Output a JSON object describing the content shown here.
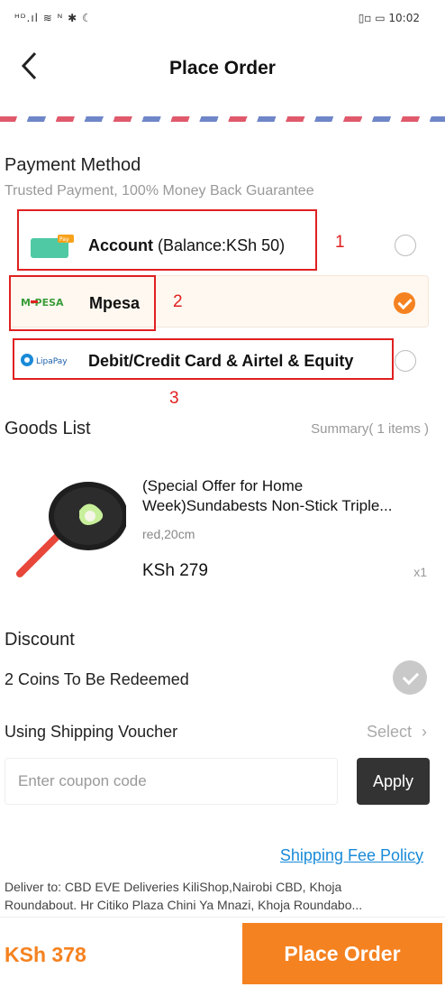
{
  "status_bar": {
    "left": "ᴴᴰ.ıl ≋ ᴺ ✱ ☾",
    "right": "▯▫ ▭ 10:02"
  },
  "header": {
    "title": "Place Order"
  },
  "payment": {
    "title": "Payment Method",
    "subtitle": "Trusted Payment, 100% Money Back Guarantee",
    "methods": [
      {
        "label": "Account",
        "extra": "(Balance:KSh 50)",
        "selected": false,
        "icon": "wallet-icon"
      },
      {
        "label": "Mpesa",
        "extra": "",
        "selected": true,
        "icon": "mpesa-logo"
      },
      {
        "label": "Debit/Credit Card & Airtel & Equity",
        "extra": "",
        "selected": false,
        "icon": "lipapay-logo"
      }
    ],
    "markers": [
      "1",
      "2",
      "3"
    ]
  },
  "goods": {
    "title": "Goods List",
    "summary": "Summary( 1 items )",
    "item": {
      "name_line1": "(Special Offer for Home",
      "name_line2": "Week)Sundabests Non-Stick Triple...",
      "variant": "red,20cm",
      "price": "KSh 279",
      "qty": "x1"
    }
  },
  "discount": {
    "title": "Discount",
    "coins": "2 Coins To Be Redeemed",
    "voucher_label": "Using Shipping Voucher",
    "voucher_action": "Select",
    "coupon_placeholder": "Enter coupon code",
    "apply_label": "Apply"
  },
  "shipping": {
    "policy_link": "Shipping Fee Policy",
    "deliver_line1": "Deliver to: CBD EVE Deliveries KiliShop,Nairobi CBD, Khoja",
    "deliver_line2": "Roundabout. Hr Citiko Plaza Chini Ya Mnazi, Khoja Roundabo..."
  },
  "footer": {
    "total": "KSh 378",
    "place_order": "Place Order"
  },
  "colors": {
    "accent": "#f58220",
    "marker": "#e02020",
    "link": "#1a8ad8"
  },
  "logos": {
    "mpesa": "M-PESA",
    "lipapay": "LipaPay",
    "wallet_tag": "Pay"
  }
}
